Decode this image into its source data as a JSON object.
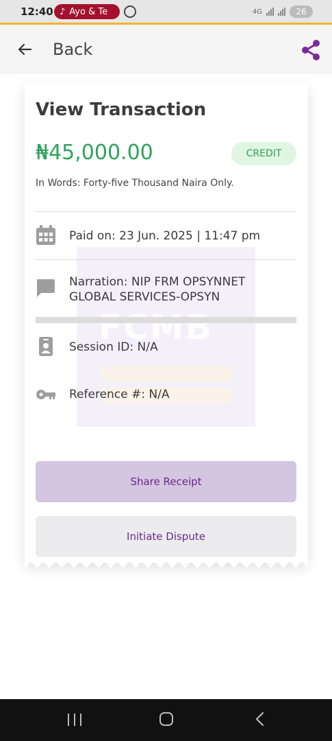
{
  "status_bar": {
    "time": "12:40",
    "notification": "Ayo & Te",
    "network": "4G",
    "battery": "26"
  },
  "header": {
    "back_label": "Back",
    "back_icon": "arrow-left-icon",
    "share_icon": "share-icon"
  },
  "transaction": {
    "title": "View Transaction",
    "amount": "₦45,000.00",
    "type_badge": "CREDIT",
    "in_words": "In Words: Forty-five Thousand Naira  Only.",
    "paid_on": "Paid on: 23 Jun. 2025 | 11:47 pm",
    "narration_line1": "Narration: NIP FRM OPSYNNET",
    "narration_line2": "GLOBAL SERVICES-OPSYN",
    "session_id": "Session ID: N/A",
    "reference": "Reference #: N/A",
    "watermark": "FCMB"
  },
  "actions": {
    "share_receipt": "Share Receipt",
    "initiate_dispute": "Initiate Dispute"
  },
  "colors": {
    "brand": "#6a2a8a",
    "amount": "#2ea35a",
    "accent": "#f3b22c"
  }
}
